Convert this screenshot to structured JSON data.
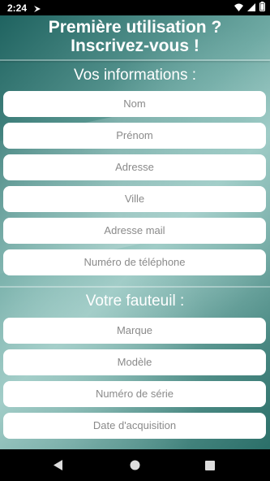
{
  "status_bar": {
    "time": "2:24",
    "icons": [
      "notification-icon",
      "wifi-icon",
      "signal-icon",
      "battery-icon"
    ]
  },
  "header": {
    "title_line1": "Première utilisation ?",
    "title_line2": "Inscrivez-vous  !"
  },
  "personal_section": {
    "title": "Vos informations :",
    "fields": [
      {
        "placeholder": "Nom"
      },
      {
        "placeholder": "Prénom"
      },
      {
        "placeholder": "Adresse"
      },
      {
        "placeholder": "Ville"
      },
      {
        "placeholder": "Adresse mail"
      },
      {
        "placeholder": "Numéro de téléphone"
      }
    ]
  },
  "chair_section": {
    "title": "Votre fauteuil :",
    "fields": [
      {
        "placeholder": "Marque"
      },
      {
        "placeholder": "Modèle"
      },
      {
        "placeholder": "Numéro de série"
      },
      {
        "placeholder": "Date d'acquisition"
      }
    ]
  },
  "nav_bar": {
    "buttons": [
      "back-icon",
      "home-icon",
      "recents-icon"
    ]
  },
  "colors": {
    "accent": "#2b6f69",
    "field_background": "#ffffff",
    "placeholder_text": "#8a8a8a"
  }
}
